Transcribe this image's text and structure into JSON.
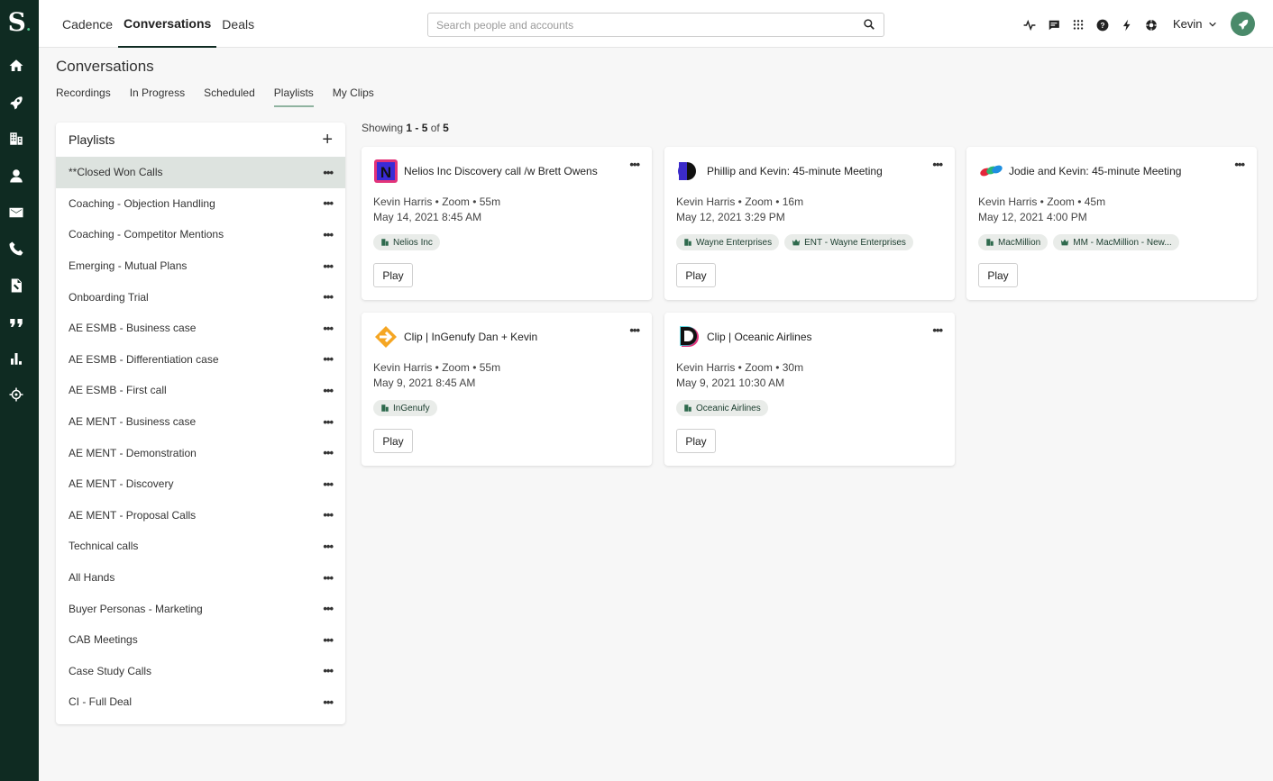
{
  "app": {
    "logo": "S",
    "brand_color": "#0f2b22",
    "accent": "#4a8a6a"
  },
  "topnav": [
    {
      "label": "Cadence"
    },
    {
      "label": "Conversations"
    },
    {
      "label": "Deals"
    }
  ],
  "search": {
    "placeholder": "Search people and accounts"
  },
  "toolbar_icons": [
    "activity-icon",
    "chat-icon",
    "apps-grid-icon",
    "help-icon",
    "bolt-icon",
    "settings-icon"
  ],
  "user": {
    "name": "Kevin"
  },
  "page": {
    "title": "Conversations"
  },
  "subtabs": [
    {
      "label": "Recordings"
    },
    {
      "label": "In Progress"
    },
    {
      "label": "Scheduled"
    },
    {
      "label": "Playlists"
    },
    {
      "label": "My Clips"
    }
  ],
  "playlists": {
    "title": "Playlists",
    "items": [
      "**Closed Won Calls",
      "Coaching - Objection Handling",
      "Coaching - Competitor Mentions",
      "Emerging - Mutual Plans",
      "Onboarding Trial",
      "AE ESMB - Business case",
      "AE ESMB - Differentiation case",
      "AE ESMB - First call",
      "AE MENT - Business case",
      "AE MENT - Demonstration",
      "AE MENT - Discovery",
      "AE MENT - Proposal Calls",
      "Technical calls",
      "All Hands",
      "Buyer Personas - Marketing",
      "CAB Meetings",
      "Case Study Calls",
      "CI - Full Deal"
    ]
  },
  "showing": {
    "prefix": "Showing",
    "range": "1 - 5",
    "of": "of",
    "total": "5"
  },
  "cards": [
    {
      "title": "Nelios Inc Discovery call /w Brett Owens",
      "meta1": "Kevin Harris • Zoom • 55m",
      "meta2": "May 14, 2021 8:45 AM",
      "chips": [
        "Nelios Inc"
      ],
      "chip2": "",
      "play": "Play"
    },
    {
      "title": "Phillip and Kevin: 45-minute Meeting",
      "meta1": "Kevin Harris • Zoom • 16m",
      "meta2": "May 12, 2021 3:29 PM",
      "chips": [
        "Wayne Enterprises"
      ],
      "chip2": "ENT - Wayne Enterprises",
      "play": "Play"
    },
    {
      "title": "Jodie and Kevin: 45-minute Meeting",
      "meta1": "Kevin Harris • Zoom • 45m",
      "meta2": "May 12, 2021 4:00 PM",
      "chips": [
        "MacMillion"
      ],
      "chip2": "MM - MacMillion - New...",
      "play": "Play"
    },
    {
      "title": "Clip | InGenufy Dan + Kevin",
      "meta1": "Kevin Harris • Zoom • 55m",
      "meta2": "May 9, 2021 8:45 AM",
      "chips": [
        "InGenufy"
      ],
      "chip2": "",
      "play": "Play"
    },
    {
      "title": "Clip | Oceanic Airlines",
      "meta1": "Kevin Harris • Zoom • 30m",
      "meta2": "May 9, 2021 10:30 AM",
      "chips": [
        "Oceanic Airlines"
      ],
      "chip2": "",
      "play": "Play"
    }
  ]
}
